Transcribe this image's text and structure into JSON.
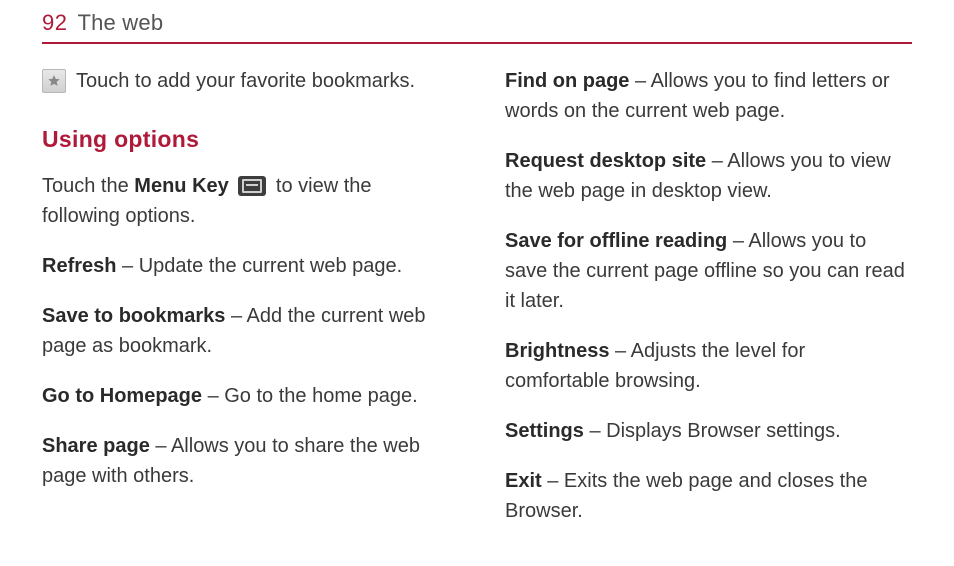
{
  "header": {
    "page_number": "92",
    "title": "The web"
  },
  "left": {
    "bookmark_tip": "Touch to add your favorite bookmarks.",
    "section_heading": "Using options",
    "intro_pre": "Touch the ",
    "intro_bold": "Menu Key",
    "intro_post": " to view the following options.",
    "items": [
      {
        "term": "Refresh",
        "desc": " – Update the current web page."
      },
      {
        "term": "Save to bookmarks",
        "desc": " – Add the current web page as bookmark."
      },
      {
        "term": "Go to Homepage",
        "desc": " – Go to the home page."
      },
      {
        "term": "Share page",
        "desc": " – Allows you to share the web page with others."
      }
    ]
  },
  "right": {
    "items": [
      {
        "term": "Find on page",
        "desc": " – Allows you to find letters or words on the current web page."
      },
      {
        "term": "Request desktop site",
        "desc": " – Allows you to view the web page in desktop view."
      },
      {
        "term": "Save for offline reading",
        "desc": " – Allows you to save the current page offline so you can read it later."
      },
      {
        "term": "Brightness",
        "desc": " – Adjusts the level for comfortable browsing."
      },
      {
        "term": "Settings",
        "desc": " – Displays Browser settings."
      },
      {
        "term": "Exit",
        "desc": " – Exits the web page and closes the Browser."
      }
    ]
  }
}
